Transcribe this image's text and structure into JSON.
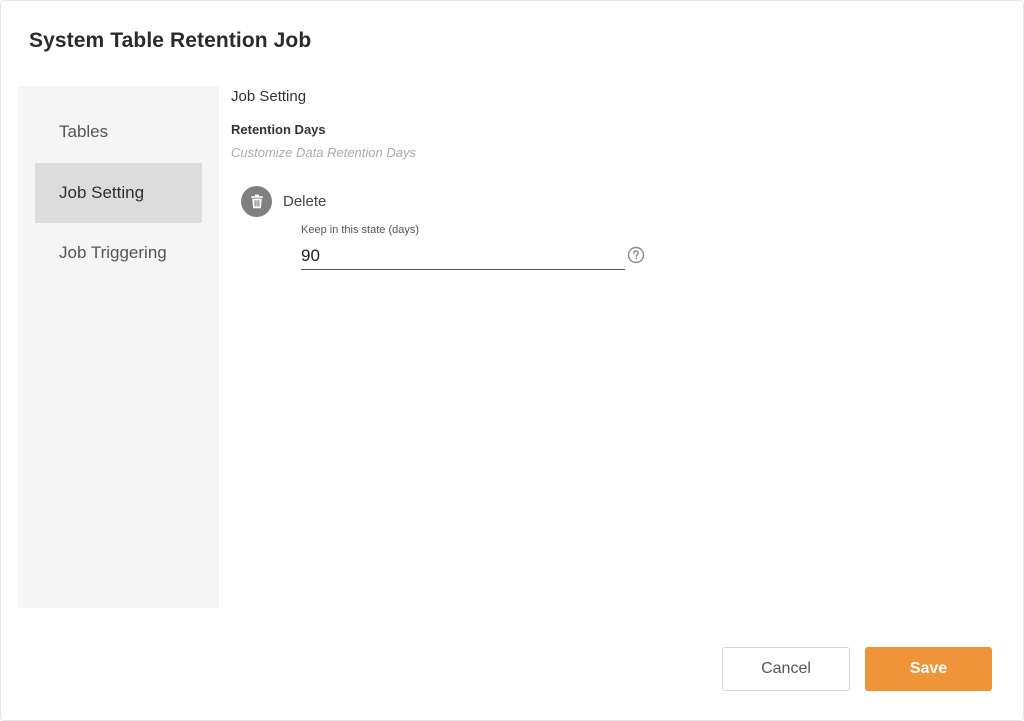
{
  "dialog": {
    "title": "System Table Retention Job"
  },
  "sidebar": {
    "items": [
      {
        "label": "Tables",
        "active": false
      },
      {
        "label": "Job Setting",
        "active": true
      },
      {
        "label": "Job Triggering",
        "active": false
      }
    ]
  },
  "main": {
    "section_heading": "Job Setting",
    "field_label": "Retention Days",
    "field_hint": "Customize Data Retention Days",
    "action": {
      "icon": "trash-icon",
      "label": "Delete"
    },
    "input": {
      "caption": "Keep in this state (days)",
      "value": "90",
      "help_icon": "question-circle-icon"
    }
  },
  "footer": {
    "cancel_label": "Cancel",
    "save_label": "Save"
  },
  "colors": {
    "accent": "#f0943a",
    "sidebar_bg": "#f5f5f5",
    "active_item_bg": "#dcdcdc",
    "icon_bg": "#808080"
  }
}
